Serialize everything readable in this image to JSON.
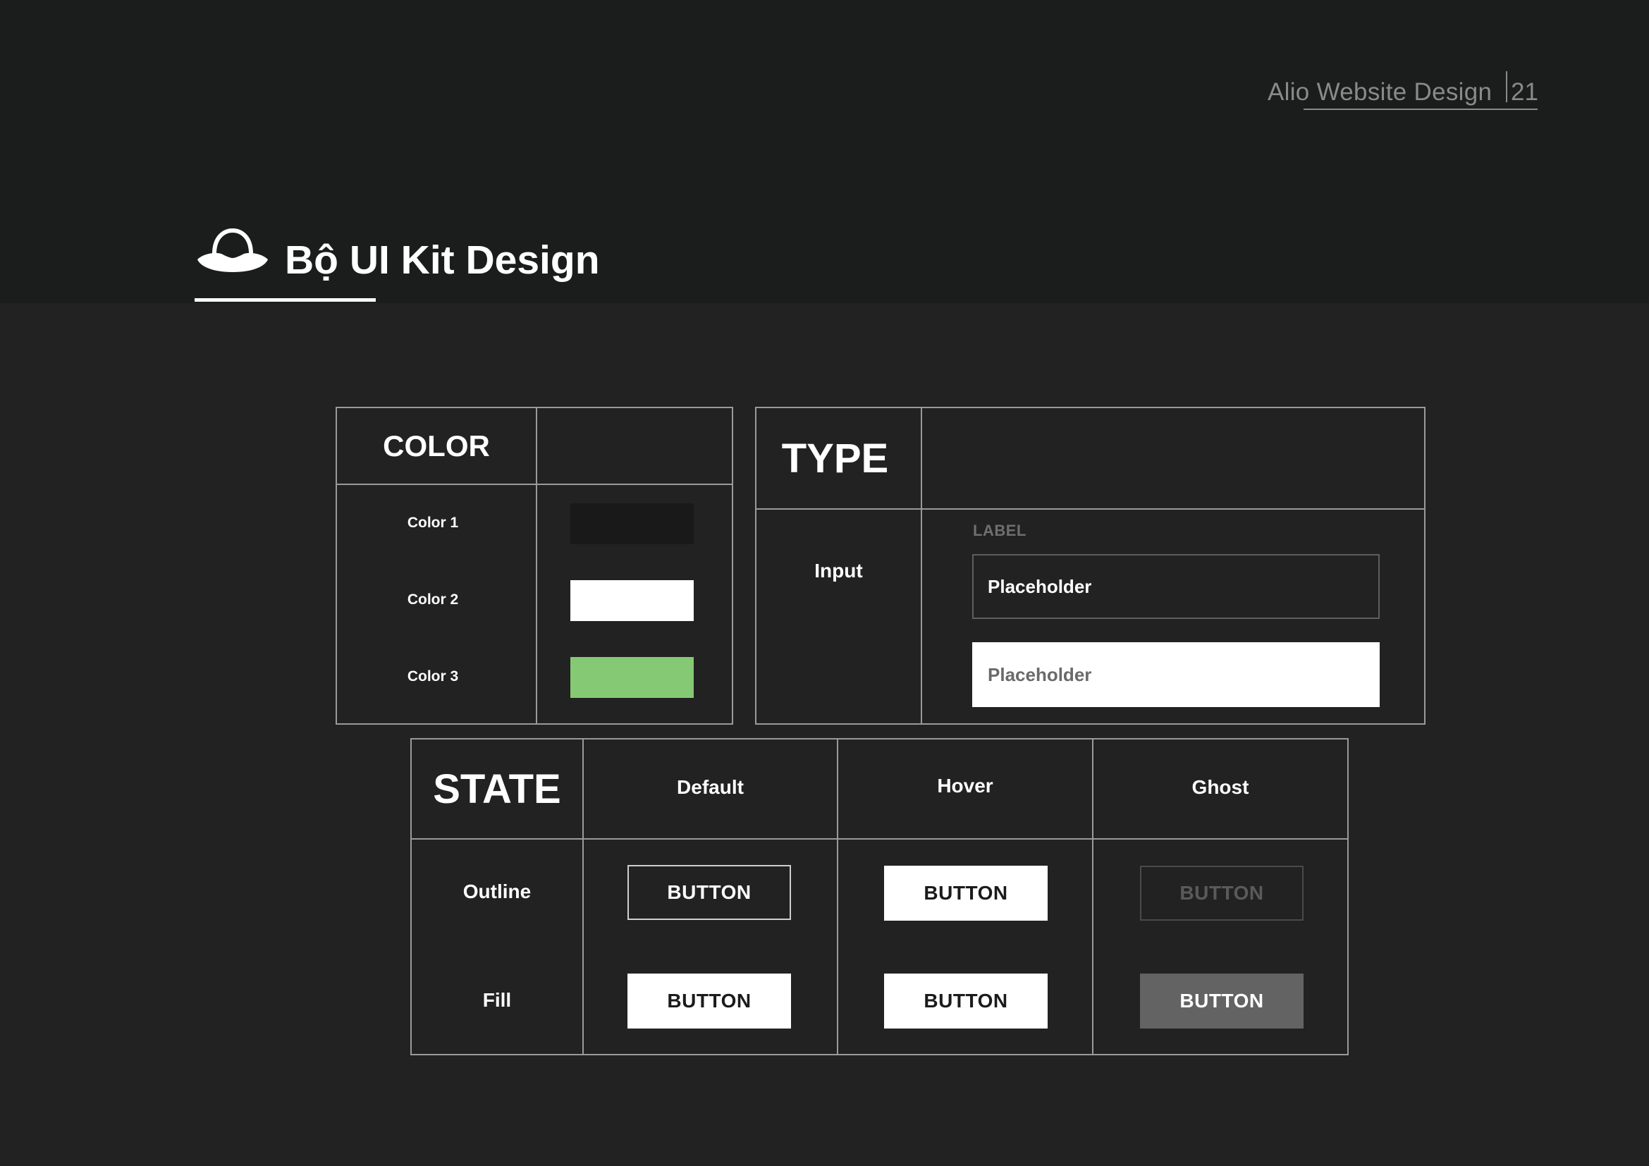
{
  "header": {
    "brand": "Alio Website Design",
    "page_number": "21",
    "title": "Bộ UI Kit Design",
    "icon": "ufo-hat-icon"
  },
  "color_section": {
    "heading": "COLOR",
    "items": [
      {
        "label": "Color 1",
        "value": "#191919"
      },
      {
        "label": "Color 2",
        "value": "#ffffff"
      },
      {
        "label": "Color 3",
        "value": "#85c975"
      }
    ]
  },
  "type_section": {
    "heading": "TYPE",
    "row_label": "Input",
    "field_label": "LABEL",
    "input_dark_placeholder": "Placeholder",
    "input_light_placeholder": "Placeholder"
  },
  "state_section": {
    "heading": "STATE",
    "columns": [
      "Default",
      "Hover",
      "Ghost"
    ],
    "rows": [
      "Outline",
      "Fill"
    ],
    "button_label": "BUTTON"
  },
  "colors": {
    "top_band": "#1b1c1c",
    "page_bg": "#222222",
    "border": "#9a9a9a",
    "accent_green": "#85c975",
    "ghost_fill": "#636363"
  }
}
